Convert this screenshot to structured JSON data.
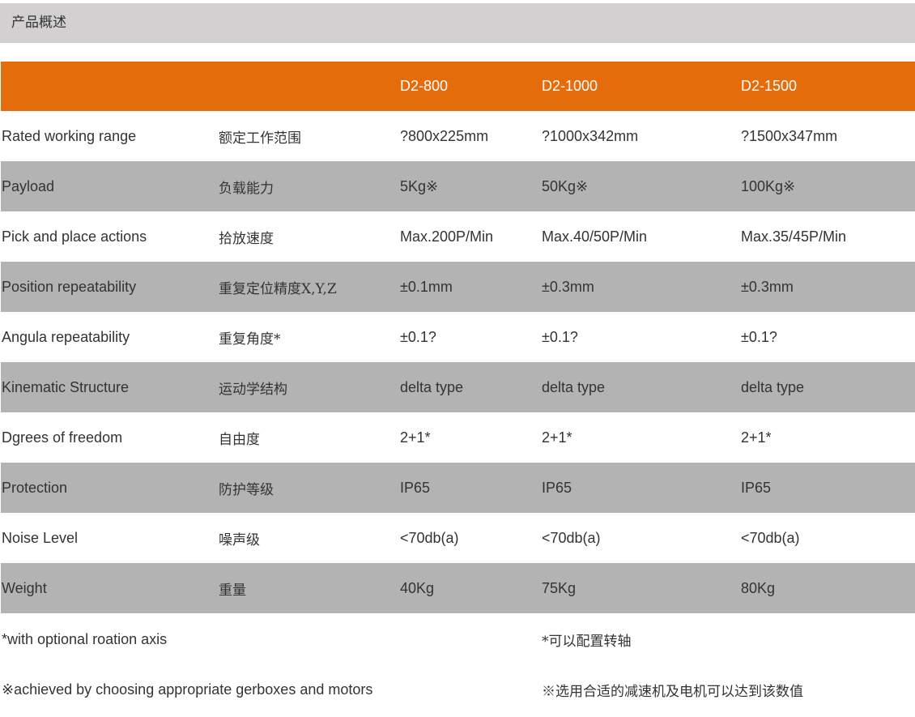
{
  "section": {
    "title": "产品概述"
  },
  "table": {
    "header": {
      "col_en": "",
      "col_cn": "",
      "models": [
        "D2-800",
        "D2-1000",
        "D2-1500"
      ]
    },
    "rows": [
      {
        "en": "Rated working range",
        "cn": "额定工作范围",
        "values": [
          "?800x225mm",
          "?1000x342mm",
          "?1500x347mm"
        ]
      },
      {
        "en": "Payload",
        "cn": "负载能力",
        "values": [
          "5Kg※",
          "50Kg※",
          "100Kg※"
        ]
      },
      {
        "en": "Pick and place actions",
        "cn": "拾放速度",
        "values": [
          "Max.200P/Min",
          "Max.40/50P/Min",
          "Max.35/45P/Min"
        ]
      },
      {
        "en": "Position repeatability",
        "cn": "重复定位精度X,Y,Z",
        "values": [
          "±0.1mm",
          "±0.3mm",
          "±0.3mm"
        ]
      },
      {
        "en": "Angula repeatability",
        "cn": "重复角度*",
        "values": [
          "±0.1?",
          "±0.1?",
          "±0.1?"
        ]
      },
      {
        "en": "Kinematic Structure",
        "cn": "运动学结构",
        "values": [
          "delta type",
          "delta type",
          "delta type"
        ]
      },
      {
        "en": "Dgrees of freedom",
        "cn": "自由度",
        "values": [
          "2+1*",
          "2+1*",
          "2+1*"
        ]
      },
      {
        "en": "Protection",
        "cn": "防护等级",
        "values": [
          "IP65",
          "IP65",
          "IP65"
        ]
      },
      {
        "en": "Noise Level",
        "cn": "噪声级",
        "values": [
          "<70db(a)",
          "<70db(a)",
          "<70db(a)"
        ]
      },
      {
        "en": "Weight",
        "cn": "重量",
        "values": [
          "40Kg",
          "75Kg",
          "80Kg"
        ]
      }
    ]
  },
  "notes": [
    {
      "en": "*with optional roation axis",
      "cn": "*可以配置转轴"
    },
    {
      "en": "※achieved  by choosing appropriate gerboxes and motors",
      "cn": "※选用合适的减速机及电机可以达到该数值"
    }
  ],
  "colors": {
    "header_bar": "#d2d0d1",
    "table_head": "#e46c0a",
    "shaded_row": "#b3b3b3"
  }
}
